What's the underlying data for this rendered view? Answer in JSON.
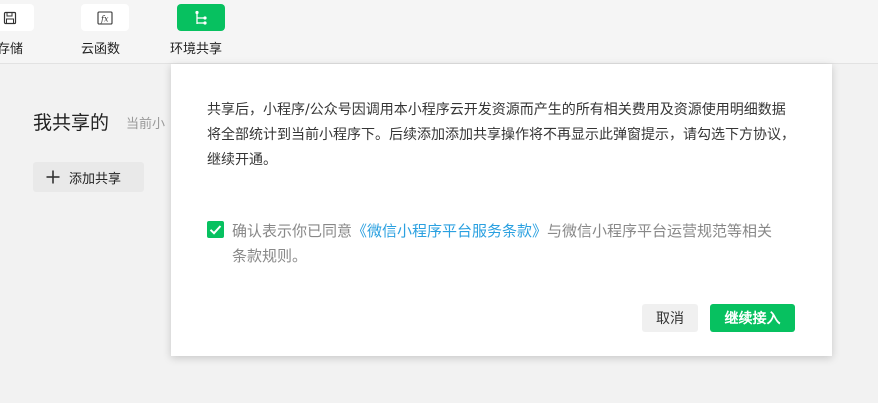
{
  "toolbar": {
    "items": [
      {
        "label": "存储",
        "icon": "floppy-disk-icon"
      },
      {
        "label": "云函数",
        "icon": "fx-icon"
      },
      {
        "label": "环境共享",
        "icon": "share-branch-icon",
        "active": true
      }
    ]
  },
  "page": {
    "title": "我共享的",
    "subtitle": "当前小",
    "add_button": "添加共享"
  },
  "dialog": {
    "notice": "共享后，小程序/公众号因调用本小程序云开发资源而产生的所有相关费用及资源使用明细数据将全部统计到当前小程序下。后续添加添加共享操作将不再显示此弹窗提示，请勾选下方协议，继续开通。",
    "agreement_prefix": "确认表示你已同意",
    "agreement_link": "《微信小程序平台服务条款》",
    "agreement_suffix": "与微信小程序平台运营规范等相关条款规则。",
    "checkbox_checked": true,
    "cancel_label": "取消",
    "confirm_label": "继续接入"
  },
  "colors": {
    "accent": "#07c160",
    "link": "#2aa0e0"
  }
}
